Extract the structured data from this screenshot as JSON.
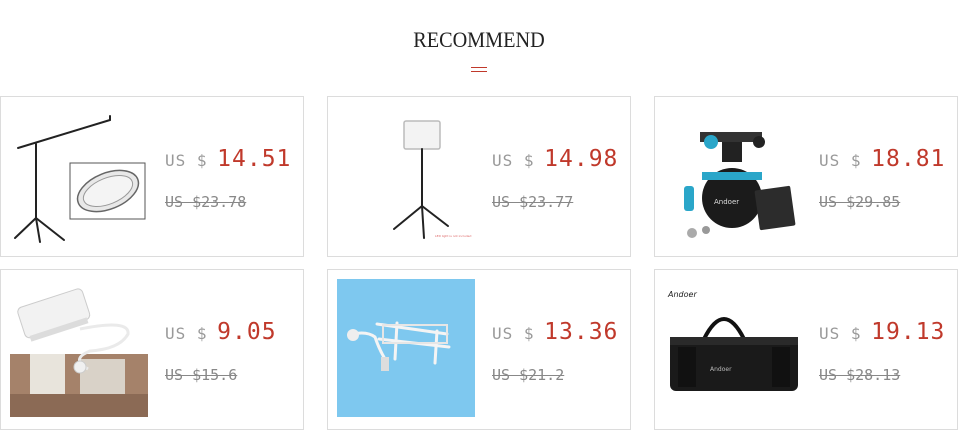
{
  "section": {
    "title": "RECOMMEND"
  },
  "products": [
    {
      "image_icon": "boom-stand-reflector-image",
      "currency": "US $",
      "price": "14.51",
      "old_price": "US $23.78"
    },
    {
      "image_icon": "led-light-stand-image",
      "currency": "US $",
      "price": "14.98",
      "old_price": "US $23.77"
    },
    {
      "image_icon": "tripod-ball-head-image",
      "currency": "US $",
      "price": "18.81",
      "old_price": "US $29.85"
    },
    {
      "image_icon": "white-sensor-box-image",
      "currency": "US $",
      "price": "9.05",
      "old_price": "US $15.6"
    },
    {
      "image_icon": "antenna-mount-image",
      "currency": "US $",
      "price": "13.36",
      "old_price": "US $21.2"
    },
    {
      "image_icon": "andoer-carry-bag-image",
      "currency": "US $",
      "price": "19.13",
      "old_price": "US $28.13"
    }
  ],
  "image_texts": {
    "tiny_caption": "LED light is not included",
    "ballhead_brand": "Andoer",
    "bag_brand": "Andoer"
  },
  "colors": {
    "price": "#c0392b",
    "accent_line": "#c0392b",
    "border": "#dcdcdc"
  }
}
